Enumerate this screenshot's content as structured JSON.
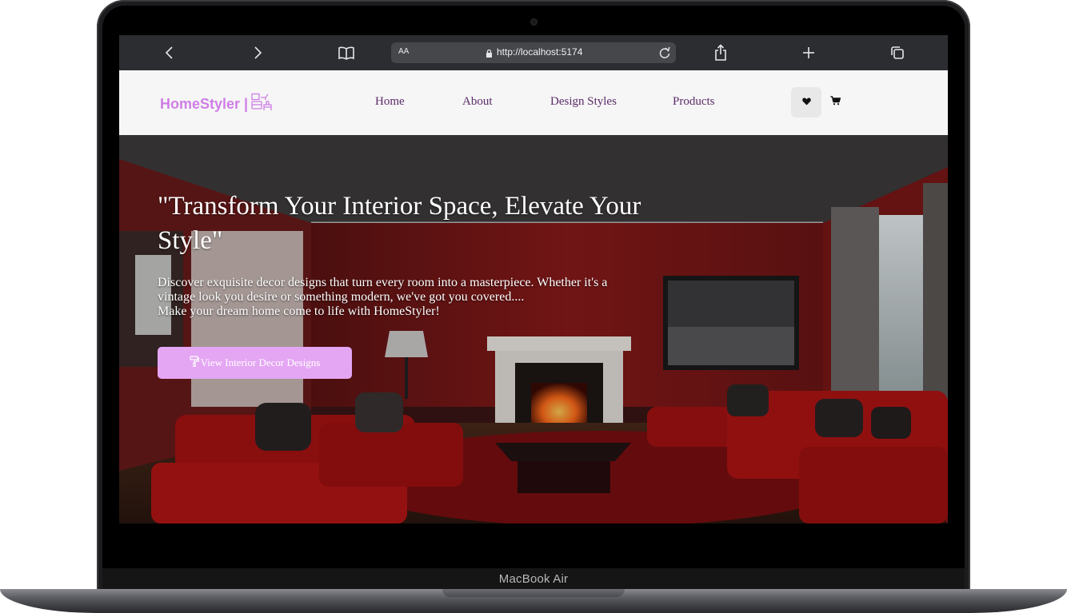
{
  "device": {
    "label": "MacBook Air"
  },
  "browser": {
    "text_size_label": "AA",
    "url": "http://localhost:5174",
    "icons": [
      "back-icon",
      "forward-icon",
      "bookmarks-icon",
      "lock-icon",
      "reload-icon",
      "share-icon",
      "new-tab-icon",
      "tabs-icon"
    ]
  },
  "site": {
    "logo": "HomeStyler |",
    "logo_icon": "furniture-icon",
    "nav": [
      "Home",
      "About",
      "Design Styles",
      "Products"
    ],
    "nav_icons": [
      "heart-icon",
      "cart-icon"
    ],
    "hero": {
      "title": "\"Transform Your Interior Space, Elevate Your Style\"",
      "lines": [
        "Discover exquisite decor designs that turn every room into a masterpiece. Whether it's a",
        "vintage look you desire or something modern, we've got you covered....",
        "Make your dream home come to life with HomeStyler!"
      ],
      "cta": "View Interior Decor Designs",
      "cta_icon": "paint-roller-icon"
    },
    "colors": {
      "brand": "#cf7ee6",
      "cta": "#e4a6f3",
      "nav_text": "#5a2a68"
    }
  }
}
